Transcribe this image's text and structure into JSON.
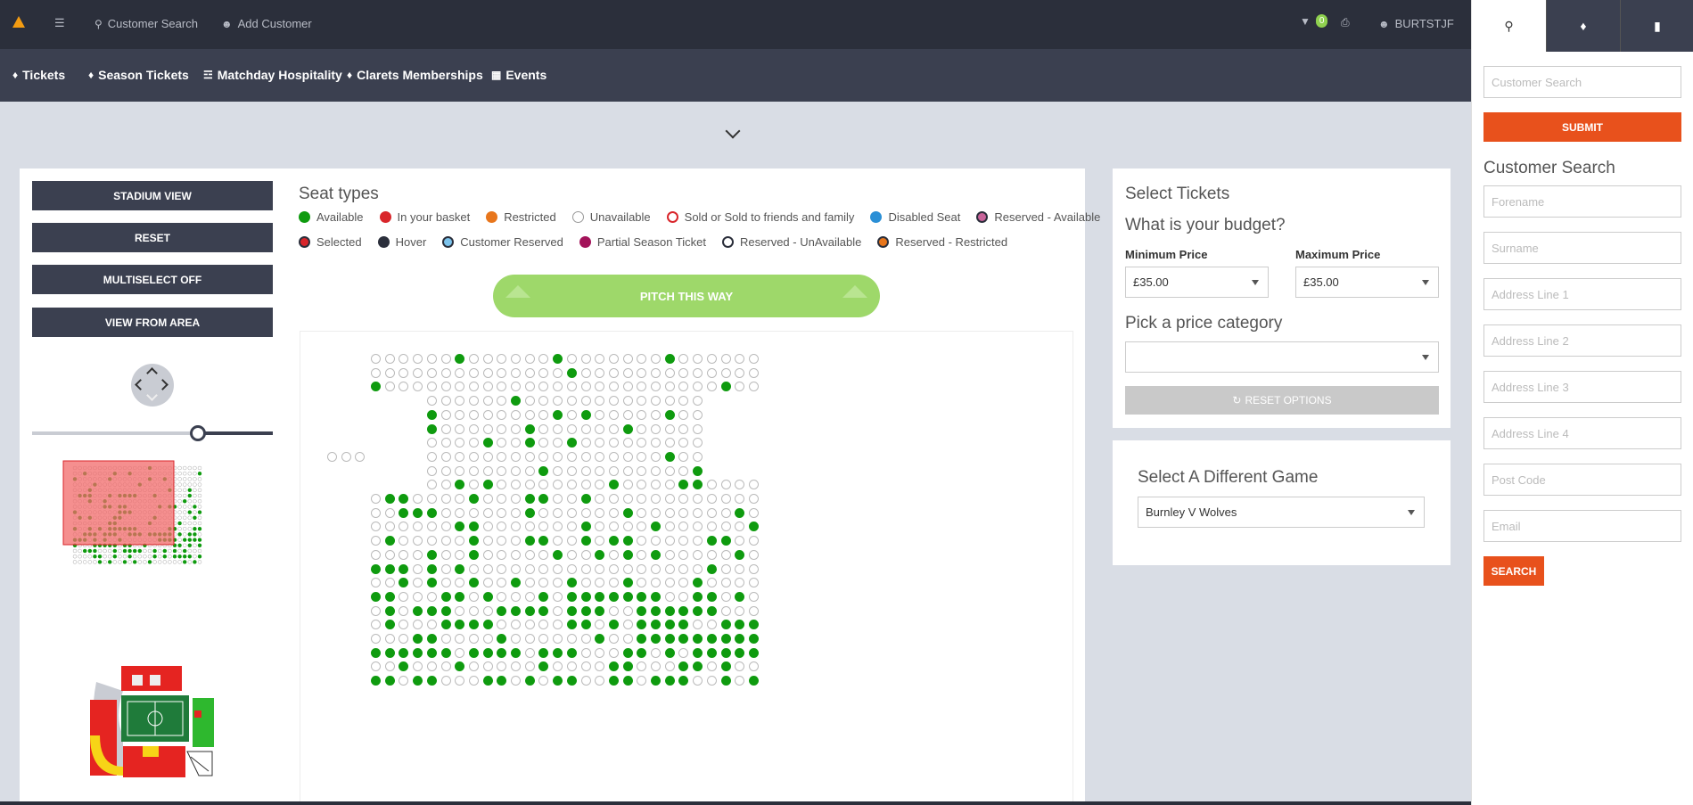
{
  "topbar": {
    "logo": "logo-icon",
    "customer_search": "Customer Search",
    "add_customer": "Add Customer",
    "basket_count": "0",
    "user": "BURTSTJF"
  },
  "nav": {
    "items": [
      {
        "label": "Tickets",
        "icon": "ticket-icon"
      },
      {
        "label": "Season Tickets",
        "icon": "ticket-icon"
      },
      {
        "label": "Matchday Hospitality",
        "icon": "cutlery-icon"
      },
      {
        "label": "Clarets Memberships",
        "icon": "ticket-icon"
      },
      {
        "label": "Events",
        "icon": "calendar-icon"
      }
    ]
  },
  "left_panel": {
    "buttons": [
      "STADIUM VIEW",
      "RESET",
      "MULTISELECT OFF",
      "VIEW FROM AREA"
    ],
    "zoom_level": 0.69
  },
  "seat_types": {
    "title": "Seat types",
    "items": [
      {
        "label": "Available",
        "color": "#0f9b0f",
        "style": "fill"
      },
      {
        "label": "In your basket",
        "color": "#d9262b",
        "style": "fill"
      },
      {
        "label": "Restricted",
        "color": "#e8761c",
        "style": "fill"
      },
      {
        "label": "Unavailable",
        "color": "#ffffff",
        "style": "outline-grey"
      },
      {
        "label": "Sold or Sold to friends and family",
        "color": "#d9262b",
        "style": "outline"
      },
      {
        "label": "Disabled Seat",
        "color": "#2a8fd6",
        "style": "fill"
      },
      {
        "label": "Reserved - Available",
        "color": "#c8649a",
        "style": "fill-dark-border"
      },
      {
        "label": "Selected",
        "color": "#d9262b",
        "style": "fill-dark-border"
      },
      {
        "label": "Hover",
        "color": "#2b2f3b",
        "style": "fill"
      },
      {
        "label": "Customer Reserved",
        "color": "#7cc3ec",
        "style": "fill-dark-border"
      },
      {
        "label": "Partial Season Ticket",
        "color": "#a3135a",
        "style": "fill"
      },
      {
        "label": "Reserved - UnAvailable",
        "color": "#ffffff",
        "style": "outline-dark"
      },
      {
        "label": "Reserved - Restricted",
        "color": "#e8761c",
        "style": "fill-dark-border"
      }
    ],
    "pitch_label": "PITCH THIS WAY"
  },
  "select_tickets": {
    "title": "Select Tickets",
    "budget_title": "What is your budget?",
    "min_label": "Minimum Price",
    "min_value": "£35.00",
    "max_label": "Maximum Price",
    "max_value": "£35.00",
    "category_title": "Pick a price category",
    "category_value": "",
    "reset_label": "RESET OPTIONS"
  },
  "different_game": {
    "title": "Select A Different Game",
    "value": "Burnley V Wolves"
  },
  "sidebar": {
    "tabs": [
      "search-icon",
      "ticket-icon",
      "bookmark-icon"
    ],
    "customer_search_placeholder": "Customer Search",
    "submit_label": "SUBMIT",
    "heading": "Customer Search",
    "fields": [
      "Forename",
      "Surname",
      "Address Line 1",
      "Address Line 2",
      "Address Line 3",
      "Address Line 4",
      "Post Code",
      "Email"
    ],
    "search_label": "SEARCH"
  },
  "colors": {
    "accent": "#e8511c",
    "dark": "#2b2f3b",
    "nav": "#3b4050",
    "pitch": "#9ed86a",
    "available": "#0f9b0f"
  }
}
